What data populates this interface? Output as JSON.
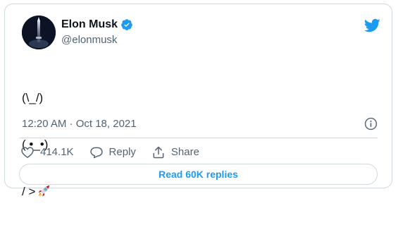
{
  "author": {
    "name": "Elon Musk",
    "handle": "@elonmusk",
    "verified": true
  },
  "tweet": {
    "lines": [
      "(\\_/)",
      "( •_•)",
      "/ >"
    ],
    "emoji_icon": "rocket-icon",
    "timestamp": "12:20 AM · Oct 18, 2021"
  },
  "actions": {
    "like_count": "414.1K",
    "reply_label": "Reply",
    "share_label": "Share"
  },
  "read_replies": {
    "label": "Read 60K replies"
  },
  "colors": {
    "brand_blue": "#1d9bf0",
    "secondary_text": "#536471",
    "border": "#cfd9de"
  }
}
